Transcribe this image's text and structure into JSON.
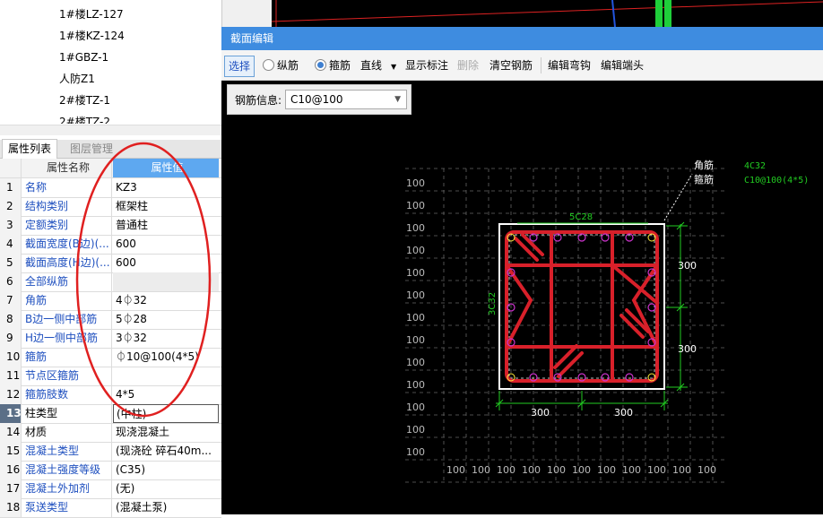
{
  "tree": {
    "items": [
      "1#楼LZ-127",
      "1#楼KZ-124",
      "1#GBZ-1",
      "人防Z1",
      "2#楼TZ-1",
      "2#楼TZ-2"
    ]
  },
  "tabs": [
    "属性列表",
    "图层管理"
  ],
  "properties": {
    "header": {
      "name": "属性名称",
      "value": "属性值"
    },
    "rows": [
      {
        "num": "1",
        "name": "名称",
        "value": "KZ3"
      },
      {
        "num": "2",
        "name": "结构类别",
        "value": "框架柱"
      },
      {
        "num": "3",
        "name": "定额类别",
        "value": "普通柱"
      },
      {
        "num": "4",
        "name": "截面宽度(B边)(...",
        "value": "600"
      },
      {
        "num": "5",
        "name": "截面高度(H边)(...",
        "value": "600"
      },
      {
        "num": "6",
        "name": "全部纵筋",
        "value": ""
      },
      {
        "num": "7",
        "name": "角筋",
        "value": "4⏀32"
      },
      {
        "num": "8",
        "name": "B边一侧中部筋",
        "value": "5⏀28"
      },
      {
        "num": "9",
        "name": "H边一侧中部筋",
        "value": "3⏀32"
      },
      {
        "num": "10",
        "name": "箍筋",
        "value": "⏀10@100(4*5)"
      },
      {
        "num": "11",
        "name": "节点区箍筋",
        "value": ""
      },
      {
        "num": "12",
        "name": "箍筋肢数",
        "value": "4*5"
      },
      {
        "num": "13",
        "name": "柱类型",
        "value": "(中柱)"
      },
      {
        "num": "14",
        "name": "材质",
        "value": "现浇混凝土"
      },
      {
        "num": "15",
        "name": "混凝土类型",
        "value": "(现浇砼 碎石40m..."
      },
      {
        "num": "16",
        "name": "混凝土强度等级",
        "value": "(C35)"
      },
      {
        "num": "17",
        "name": "混凝土外加剂",
        "value": "(无)"
      },
      {
        "num": "18",
        "name": "泵送类型",
        "value": "(混凝土泵)"
      }
    ]
  },
  "dialog": {
    "title": "截面编辑",
    "toolbar": {
      "select": "选择",
      "longitudinal": "纵筋",
      "stirrup": "箍筋",
      "line": "直线",
      "show_dims": "显示标注",
      "delete": "删除",
      "clear": "清空钢筋",
      "edit_hook": "编辑弯钩",
      "edit_end": "编辑端头"
    },
    "rebar_info_label": "钢筋信息:",
    "rebar_info_value": "C10@100"
  },
  "drawing": {
    "corner_label": "角筋",
    "stirrup_label": "箍筋",
    "corner_value": "4C32",
    "stirrup_value": "C10@100(4*5)",
    "top_rebar": "5C28",
    "side_rebar": "3C32",
    "dim_right_top": "300",
    "dim_right_bottom": "300",
    "dim_bottom_left": "300",
    "dim_bottom_right": "300",
    "grid_label": "100"
  },
  "colors": {
    "title_bar": "#3e8ce0",
    "rebar_red": "#d8202a",
    "green_text": "#22cc22",
    "magenta_circle": "#cc33cc",
    "annotation_red": "#e02020"
  }
}
